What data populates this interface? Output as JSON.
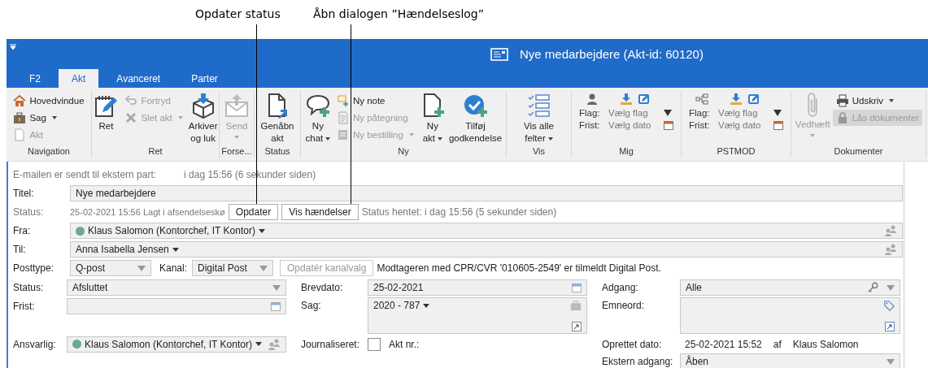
{
  "annotations": [
    {
      "text": "Opdater status"
    },
    {
      "text": "Åbn dialogen ”Hændelseslog”"
    }
  ],
  "window": {
    "title": "Nye medarbejdere (Akt-id: 60120)",
    "tabs": [
      {
        "label": "F2",
        "selected": false
      },
      {
        "label": "Akt",
        "selected": true
      },
      {
        "label": "Avanceret",
        "selected": false
      },
      {
        "label": "Parter",
        "selected": false
      }
    ]
  },
  "ribbon": [
    {
      "label": "Navigation",
      "items": [
        {
          "kind": "stack",
          "items": [
            {
              "label": "Hovedvindue",
              "disabled": false,
              "dropdown": false,
              "highlighted": false
            },
            {
              "label": "Sag",
              "disabled": false,
              "dropdown": true,
              "highlighted": false
            },
            {
              "label": "Akt",
              "disabled": true,
              "dropdown": false,
              "highlighted": false
            }
          ]
        }
      ]
    },
    {
      "label": "Ret",
      "items": [
        {
          "kind": "large",
          "label": "Ret",
          "disabled": false,
          "dropdown": false
        },
        {
          "kind": "stack",
          "items": [
            {
              "label": "Fortryd",
              "disabled": true,
              "dropdown": false,
              "highlighted": false
            },
            {
              "label": "Slet akt",
              "disabled": true,
              "dropdown": true,
              "highlighted": false
            }
          ]
        },
        {
          "kind": "large",
          "label": "Arkiver\nog luk",
          "disabled": false,
          "dropdown": false
        }
      ]
    },
    {
      "label": "Forse...",
      "items": [
        {
          "kind": "large",
          "label": "Send",
          "disabled": true,
          "dropdown": true
        }
      ]
    },
    {
      "label": "Status",
      "items": [
        {
          "kind": "large",
          "label": "Genåbn\nakt",
          "disabled": false,
          "dropdown": false
        }
      ]
    },
    {
      "label": "Ny",
      "items": [
        {
          "kind": "large",
          "label": "Ny\nchat",
          "disabled": false,
          "dropdown": true
        },
        {
          "kind": "stack",
          "items": [
            {
              "label": "Ny note",
              "disabled": false,
              "dropdown": false,
              "highlighted": false
            },
            {
              "label": "Ny påtegning",
              "disabled": true,
              "dropdown": false,
              "highlighted": false
            },
            {
              "label": "Ny bestilling",
              "disabled": true,
              "dropdown": true,
              "highlighted": false
            }
          ]
        },
        {
          "kind": "large",
          "label": "Ny\nakt",
          "disabled": false,
          "dropdown": true
        },
        {
          "kind": "large",
          "label": "Tilføj\ngodkendelse",
          "disabled": false,
          "dropdown": false
        }
      ]
    },
    {
      "label": "Vis",
      "items": [
        {
          "kind": "large",
          "label": "Vis alle\nfelter",
          "disabled": false,
          "dropdown": true
        }
      ]
    },
    {
      "label": "Mig",
      "items": [
        {
          "kind": "flags",
          "flag_label": "Flag:",
          "flag_value": "Vælg flag",
          "deadline_label": "Frist:",
          "deadline_value": "Vælg dato"
        }
      ]
    },
    {
      "label": "PSTMOD",
      "items": [
        {
          "kind": "flags",
          "flag_label": "Flag:",
          "flag_value": "Vælg flag",
          "deadline_label": "Frist:",
          "deadline_value": "Vælg dato"
        }
      ]
    },
    {
      "label": "Dokumenter",
      "items": [
        {
          "kind": "large",
          "label": "Vedhæft",
          "disabled": true,
          "dropdown": true
        },
        {
          "kind": "stack",
          "items": [
            {
              "label": "Udskriv",
              "disabled": false,
              "dropdown": true,
              "highlighted": false
            },
            {
              "label": "Lås dokumenter",
              "disabled": true,
              "dropdown": false,
              "highlighted": true
            }
          ]
        }
      ]
    }
  ],
  "form": {
    "notice": {
      "label": "E-mailen er sendt til ekstern part:",
      "value": "i dag 15:56 (6 sekunder siden)"
    },
    "title": {
      "label": "Titel:",
      "value": "Nye medarbejdere"
    },
    "status_line": {
      "label": "Status:",
      "value": "25-02-2021 15:56 Lagt i afsendelseskø",
      "buttons": [
        "Opdater",
        "Vis hændelser"
      ],
      "fetched": "Status hentet: i dag 15:56 (5 sekunder siden)"
    },
    "from": {
      "label": "Fra:",
      "value": "Klaus Salomon (Kontorchef, IT Kontor)",
      "online": true
    },
    "to": {
      "label": "Til:",
      "value": "Anna Isabella Jensen",
      "online": false
    },
    "posttype": {
      "label": "Posttype:",
      "value": "Q-post"
    },
    "channel": {
      "label": "Kanal:",
      "value": "Digital Post"
    },
    "update_channel_button": {
      "label": "Opdatér kanalvalg",
      "disabled": true
    },
    "channel_note": "Modtageren med CPR/CVR '010605-2549' er tilmeldt Digital Post.",
    "details": {
      "status": {
        "label": "Status:",
        "value": "Afsluttet"
      },
      "deadline": {
        "label": "Frist:"
      },
      "responsible": {
        "label": "Ansvarlig:",
        "value": "Klaus Salomon (Kontorchef, IT Kontor)",
        "online": true
      },
      "letter_date": {
        "label": "Brevdato:",
        "value": "25-02-2021"
      },
      "case": {
        "label": "Sag:",
        "value": "2020 - 787"
      },
      "journalized": {
        "label": "Journaliseret:",
        "checked": false
      },
      "act_no": {
        "label": "Akt nr.:"
      },
      "access": {
        "label": "Adgang:",
        "value": "Alle"
      },
      "keywords": {
        "label": "Emneord:"
      },
      "created": {
        "label": "Oprettet dato:",
        "value": "25-02-2021 15:52",
        "by_label": "af",
        "by": "Klaus Salomon"
      },
      "external_access": {
        "label": "Ekstern adgang:",
        "value": "Åben"
      }
    }
  }
}
